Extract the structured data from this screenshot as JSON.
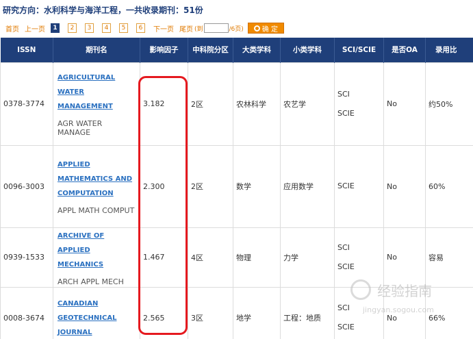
{
  "summary": "研究方向：水利科学与海洋工程，一共收录期刊：51份",
  "pager": {
    "first": "首页",
    "prev": "上一页",
    "pages": [
      "1",
      "2",
      "3",
      "4",
      "5",
      "6"
    ],
    "next": "下一页",
    "last": "尾页",
    "jump_prefix": "(到",
    "jump_suffix": "/6页)",
    "confirm": "确 定"
  },
  "columns": [
    "ISSN",
    "期刊名",
    "影响因子",
    "中科院分区",
    "大类学科",
    "小类学科",
    "SCI/SCIE",
    "是否OA",
    "录用比"
  ],
  "rows": [
    {
      "issn": "0378-3774",
      "name_lines": [
        "AGRICULTURAL",
        "WATER",
        "MANAGEMENT"
      ],
      "abbr": "AGR WATER MANAGE",
      "impact": "3.182",
      "zone": "2区",
      "major": "农林科学",
      "minor": "农艺学",
      "sci": [
        "SCI",
        "SCIE"
      ],
      "oa": "No",
      "ratio": "约50%"
    },
    {
      "issn": "0096-3003",
      "name_lines": [
        "APPLIED",
        "MATHEMATICS AND",
        "COMPUTATION"
      ],
      "abbr": "APPL MATH COMPUT",
      "impact": "2.300",
      "zone": "2区",
      "major": "数学",
      "minor": "应用数学",
      "sci": [
        "SCIE"
      ],
      "oa": "No",
      "ratio": "60%"
    },
    {
      "issn": "0939-1533",
      "name_lines": [
        "ARCHIVE OF",
        "APPLIED MECHANICS"
      ],
      "abbr": "ARCH APPL MECH",
      "impact": "1.467",
      "zone": "4区",
      "major": "物理",
      "minor": "力学",
      "sci": [
        "SCI",
        "SCIE"
      ],
      "oa": "No",
      "ratio": "容易"
    },
    {
      "issn": "0008-3674",
      "name_lines": [
        "CANADIAN",
        "GEOTECHNICAL",
        "JOURNAL"
      ],
      "abbr": "",
      "impact": "2.565",
      "zone": "3区",
      "major": "地学",
      "minor": "工程：地质",
      "sci": [
        "SCI",
        "SCIE"
      ],
      "oa": "No",
      "ratio": "66%"
    }
  ],
  "watermark": {
    "text": "经验指南",
    "sub": "jingyan.sogou.com"
  },
  "colors": {
    "header_bg": "#1f3f7a",
    "link": "#2a70c0",
    "pager_accent": "#e07a00",
    "highlight": "#e5191f"
  }
}
